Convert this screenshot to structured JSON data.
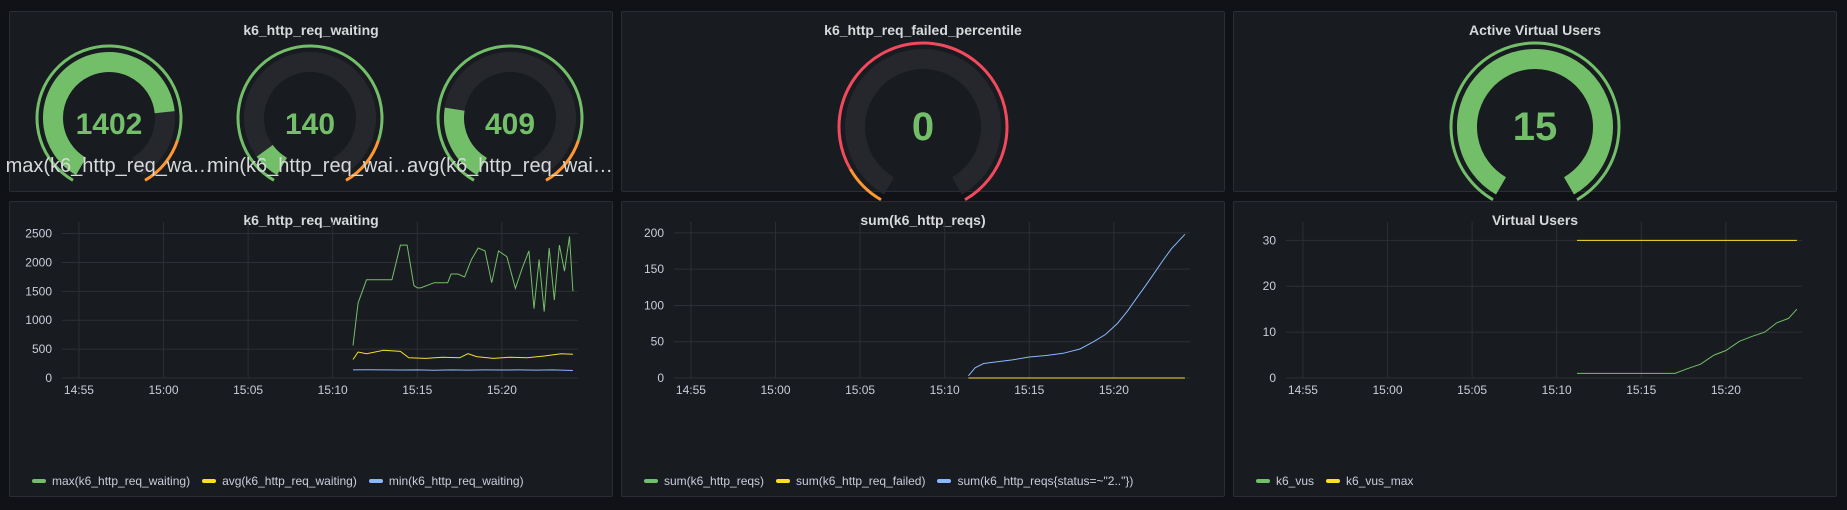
{
  "panels": {
    "waiting_gauges": {
      "title": "k6_http_req_waiting",
      "gauges": [
        {
          "value": "1402",
          "label": "max(k6_http_req_wa…",
          "fill": 0.78
        },
        {
          "value": "140",
          "label": "min(k6_http_req_wai…",
          "fill": 0.08
        },
        {
          "value": "409",
          "label": "avg(k6_http_req_wai…",
          "fill": 0.23
        }
      ]
    },
    "failed_percentile": {
      "title": "k6_http_req_failed_percentile",
      "value": "0"
    },
    "active_vus": {
      "title": "Active Virtual Users",
      "value": "15"
    },
    "waiting_chart": {
      "title": "k6_http_req_waiting",
      "legend": [
        {
          "name": "max(k6_http_req_waiting)",
          "color": "#73bf69"
        },
        {
          "name": "avg(k6_http_req_waiting)",
          "color": "#fade2a"
        },
        {
          "name": "min(k6_http_req_waiting)",
          "color": "#8ab8ff"
        }
      ]
    },
    "reqs_chart": {
      "title": "sum(k6_http_reqs)",
      "legend": [
        {
          "name": "sum(k6_http_reqs)",
          "color": "#73bf69"
        },
        {
          "name": "sum(k6_http_req_failed)",
          "color": "#fade2a"
        },
        {
          "name": "sum(k6_http_reqs{status=~\"2..\"})",
          "color": "#8ab8ff"
        }
      ]
    },
    "vus_chart": {
      "title": "Virtual Users",
      "legend": [
        {
          "name": "k6_vus",
          "color": "#73bf69"
        },
        {
          "name": "k6_vus_max",
          "color": "#fade2a"
        }
      ]
    }
  },
  "colors": {
    "green": "#73bf69",
    "yellow": "#fade2a",
    "blue": "#8ab8ff",
    "red": "#f2495c",
    "orange": "#ff9830"
  },
  "chart_data": [
    {
      "type": "line",
      "title": "k6_http_req_waiting",
      "xticks": [
        "14:55",
        "15:00",
        "15:05",
        "15:10",
        "15:15",
        "15:20"
      ],
      "x_start_min": 894.0,
      "x_end_min": 924.5,
      "ylim": [
        0,
        2700
      ],
      "yticks": [
        0,
        500,
        1000,
        1500,
        2000,
        2500
      ],
      "series": [
        {
          "name": "max(k6_http_req_waiting)",
          "color": "#73bf69",
          "x": [
            911.2,
            911.5,
            912.0,
            913.5,
            914.0,
            914.4,
            914.8,
            915.0,
            915.2,
            916.0,
            916.8,
            917.0,
            917.4,
            917.8,
            918.2,
            918.6,
            919.0,
            919.4,
            919.8,
            920.3,
            920.8,
            921.2,
            921.6,
            921.9,
            922.2,
            922.5,
            922.8,
            923.1,
            923.4,
            923.7,
            924.0,
            924.2
          ],
          "y": [
            560,
            1300,
            1700,
            1700,
            2300,
            2300,
            1600,
            1560,
            1560,
            1650,
            1650,
            1800,
            1800,
            1750,
            2050,
            2250,
            2200,
            1650,
            2200,
            2100,
            1550,
            1900,
            2200,
            1200,
            2050,
            1150,
            2250,
            1350,
            2300,
            1850,
            2450,
            1500
          ]
        },
        {
          "name": "avg(k6_http_req_waiting)",
          "color": "#fade2a",
          "x": [
            911.2,
            911.5,
            912.0,
            913.0,
            914.0,
            914.5,
            915.5,
            916.5,
            917.5,
            918.0,
            918.5,
            919.5,
            920.5,
            921.5,
            922.5,
            923.5,
            924.2
          ],
          "y": [
            320,
            450,
            420,
            480,
            460,
            350,
            340,
            360,
            350,
            420,
            370,
            340,
            360,
            350,
            380,
            420,
            410
          ]
        },
        {
          "name": "min(k6_http_req_waiting)",
          "color": "#8ab8ff",
          "x": [
            911.2,
            912.0,
            913.0,
            914.0,
            915.0,
            916.0,
            917.0,
            918.0,
            919.0,
            920.0,
            921.0,
            922.0,
            923.0,
            924.2
          ],
          "y": [
            140,
            142,
            140,
            138,
            140,
            135,
            140,
            137,
            140,
            138,
            140,
            137,
            140,
            130
          ]
        }
      ]
    },
    {
      "type": "line",
      "title": "sum(k6_http_reqs)",
      "xticks": [
        "14:55",
        "15:00",
        "15:05",
        "15:10",
        "15:15",
        "15:20"
      ],
      "x_start_min": 894.0,
      "x_end_min": 924.5,
      "ylim": [
        0,
        215
      ],
      "yticks": [
        0,
        50,
        100,
        150,
        200
      ],
      "series": [
        {
          "name": "sum(k6_http_reqs)",
          "color": "#73bf69",
          "x": [],
          "y": []
        },
        {
          "name": "sum(k6_http_req_failed)",
          "color": "#fade2a",
          "x": [
            911.4,
            924.2
          ],
          "y": [
            0,
            0
          ]
        },
        {
          "name": "sum(k6_http_reqs{status=~\"2..\"})",
          "color": "#8ab8ff",
          "x": [
            911.4,
            911.8,
            912.3,
            913.0,
            914.0,
            915.0,
            916.0,
            917.0,
            918.0,
            918.8,
            919.5,
            920.2,
            920.8,
            921.4,
            921.9,
            922.4,
            922.9,
            923.4,
            924.2
          ],
          "y": [
            3,
            14,
            20,
            22,
            25,
            29,
            31,
            34,
            40,
            50,
            60,
            75,
            92,
            112,
            128,
            145,
            162,
            178,
            198
          ]
        }
      ]
    },
    {
      "type": "line",
      "title": "Virtual Users",
      "xticks": [
        "14:55",
        "15:00",
        "15:05",
        "15:10",
        "15:15",
        "15:20"
      ],
      "x_start_min": 894.0,
      "x_end_min": 924.5,
      "ylim": [
        0,
        34
      ],
      "yticks": [
        0,
        10,
        20,
        30
      ],
      "series": [
        {
          "name": "k6_vus",
          "color": "#73bf69",
          "x": [
            911.2,
            917.0,
            917.7,
            918.5,
            919.3,
            920.0,
            920.8,
            921.5,
            922.3,
            923.0,
            923.7,
            924.2
          ],
          "y": [
            1,
            1,
            2,
            3,
            5,
            6,
            8,
            9,
            10,
            12,
            13,
            15
          ]
        },
        {
          "name": "k6_vus_max",
          "color": "#fade2a",
          "x": [
            911.2,
            924.2
          ],
          "y": [
            30,
            30
          ]
        }
      ]
    }
  ]
}
